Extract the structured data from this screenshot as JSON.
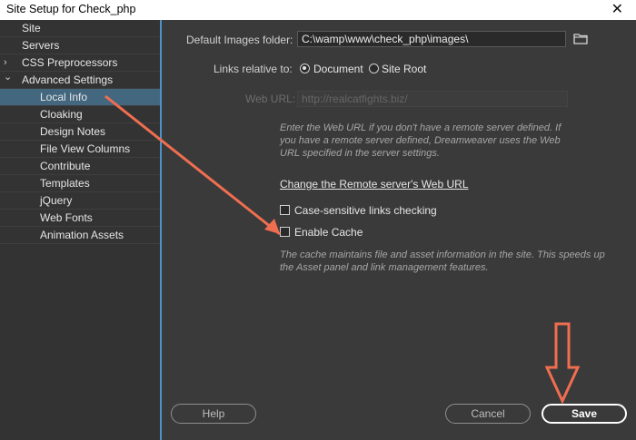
{
  "window": {
    "title": "Site Setup for Check_php",
    "close_symbol": "✕"
  },
  "sidebar": {
    "items": [
      {
        "label": "Site",
        "indent": 0,
        "chevron": "",
        "selected": false
      },
      {
        "label": "Servers",
        "indent": 0,
        "chevron": "",
        "selected": false
      },
      {
        "label": "CSS Preprocessors",
        "indent": 0,
        "chevron": "›",
        "selected": false
      },
      {
        "label": "Advanced Settings",
        "indent": 0,
        "chevron": "⌄",
        "selected": false
      },
      {
        "label": "Local Info",
        "indent": 1,
        "chevron": "",
        "selected": true
      },
      {
        "label": "Cloaking",
        "indent": 1,
        "chevron": "",
        "selected": false
      },
      {
        "label": "Design Notes",
        "indent": 1,
        "chevron": "",
        "selected": false
      },
      {
        "label": "File View Columns",
        "indent": 1,
        "chevron": "",
        "selected": false
      },
      {
        "label": "Contribute",
        "indent": 1,
        "chevron": "",
        "selected": false
      },
      {
        "label": "Templates",
        "indent": 1,
        "chevron": "",
        "selected": false
      },
      {
        "label": "jQuery",
        "indent": 1,
        "chevron": "",
        "selected": false
      },
      {
        "label": "Web Fonts",
        "indent": 1,
        "chevron": "",
        "selected": false
      },
      {
        "label": "Animation Assets",
        "indent": 1,
        "chevron": "",
        "selected": false
      }
    ]
  },
  "local_info": {
    "images_folder_label": "Default Images folder:",
    "images_folder_value": "C:\\wamp\\www\\check_php\\images\\",
    "links_relative_label": "Links relative to:",
    "radio_document": "Document",
    "radio_site_root": "Site Root",
    "links_relative_selected": "Document",
    "web_url_label": "Web URL:",
    "web_url_value": "http://realcatfights.biz/",
    "web_url_hint_1": "Enter the Web URL if you don't have a remote server defined. If",
    "web_url_hint_2": "you have a remote server defined, Dreamweaver uses the Web",
    "web_url_hint_3": "URL specified in the server settings.",
    "change_remote_link": "Change the Remote server's Web URL",
    "case_sensitive_label": "Case-sensitive links checking",
    "case_sensitive_checked": false,
    "enable_cache_label": "Enable Cache",
    "enable_cache_checked": false,
    "cache_hint_1": "The cache maintains file and asset information in the site. This speeds up",
    "cache_hint_2": "the Asset panel and link management features."
  },
  "footer": {
    "help_label": "Help",
    "cancel_label": "Cancel",
    "save_label": "Save"
  },
  "colors": {
    "sidebar_bg": "#333333",
    "sidebar_selected": "#43677f",
    "panel_bg": "#3a3a3a",
    "accent_blue": "#4e91c9",
    "annotation_orange": "#ef6e50"
  },
  "icons": {
    "folder": "folder-icon"
  }
}
